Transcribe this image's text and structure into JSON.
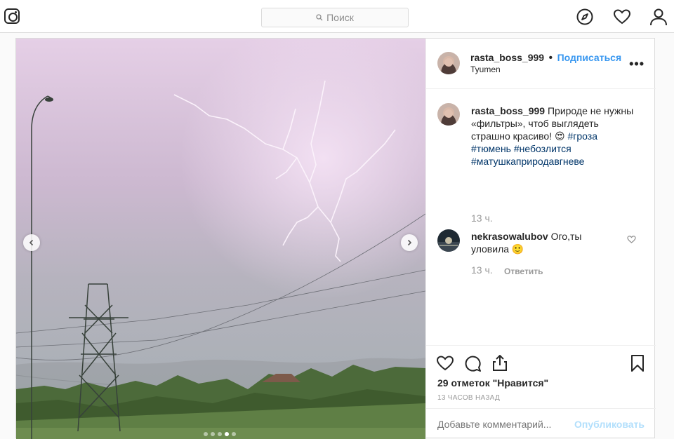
{
  "search": {
    "placeholder": "Поиск"
  },
  "icons": [
    "instagram-logo-icon",
    "search-icon",
    "compass-icon",
    "heart-icon",
    "profile-icon"
  ],
  "post": {
    "author": "rasta_boss_999",
    "follow_label": "Подписаться",
    "separator": "•",
    "location": "Tyumen",
    "more": "•••",
    "caption_author": "rasta_boss_999",
    "caption_text": " Природе не нужны «фильтры», чтоб выглядеть страшно красиво! 😍 ",
    "tags": [
      "#гроза",
      "#тюмень",
      "#небозлится",
      "#матушкаприродавгневе"
    ],
    "caption_time": "13 ч.",
    "comment": {
      "author": "nekrasowalubov",
      "text": " Ого,ты уловила 🙂",
      "time": "13 ч.",
      "reply_label": "Ответить"
    },
    "likes": "29 отметок \"Нравится\"",
    "posted_ago": "13 ЧАСОВ НАЗАД",
    "add_comment_placeholder": "Добавьте комментарий...",
    "publish_label": "Опубликовать",
    "carousel": {
      "total": 5,
      "active": 3
    }
  },
  "colors": {
    "accent": "#3897f0",
    "hashtag": "#003569",
    "muted": "#999999",
    "publish_disabled": "#b2dffc"
  }
}
